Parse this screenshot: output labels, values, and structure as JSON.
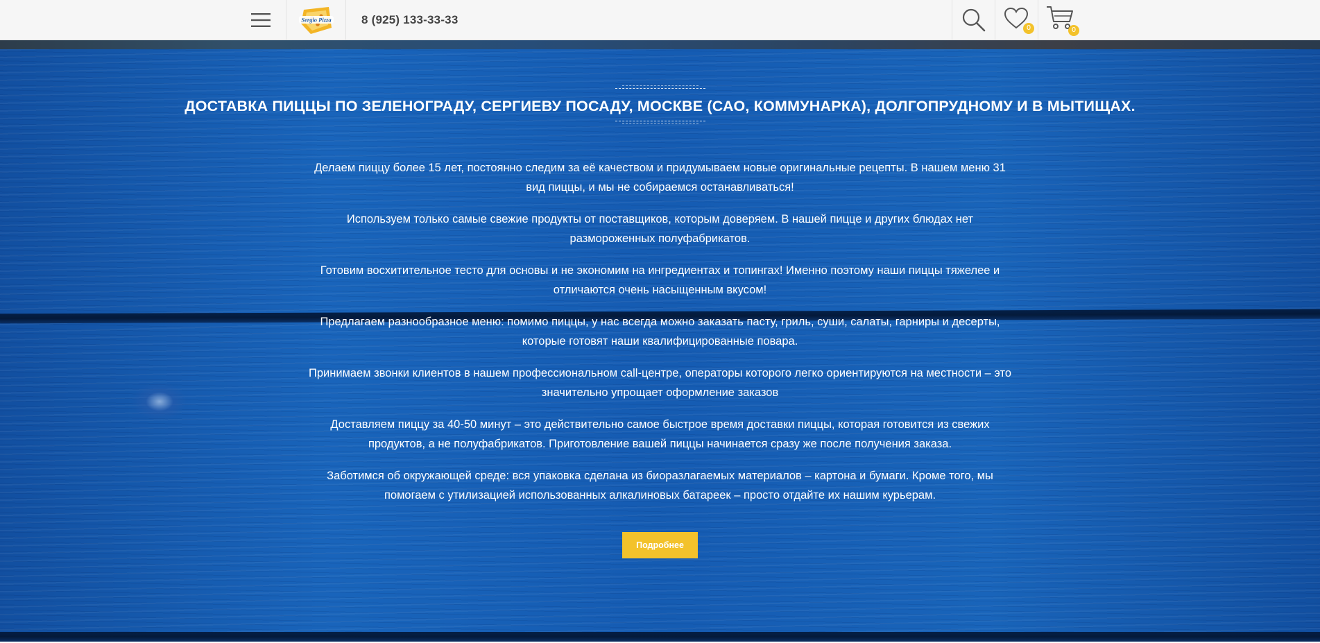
{
  "header": {
    "phone": "8 (925) 133-33-33",
    "logo_text": "Sergio Pizza",
    "wishlist_count": "0",
    "cart_count": "0"
  },
  "hero": {
    "title": "ДОСТАВКА ПИЦЦЫ ПО ЗЕЛЕНОГРАДУ, СЕРГИЕВУ ПОСАДУ, МОСКВЕ (САО, КОММУНАРКА), ДОЛГОПРУДНОМУ И В МЫТИЩАХ.",
    "paragraphs": [
      "Делаем пиццу более 15 лет, постоянно следим за её качеством и придумываем новые оригинальные рецепты. В нашем меню 31 вид пиццы, и мы не собираемся останавливаться!",
      "Используем только самые свежие продукты от поставщиков, которым доверяем. В нашей пицце и других блюдах нет размороженных полуфабрикатов.",
      "Готовим восхитительное тесто для основы и не экономим на ингредиентах и топингах! Именно поэтому наши пиццы тяжелее и отличаются очень насыщенным вкусом!",
      "Предлагаем разнообразное меню: помимо пиццы, у нас всегда можно заказать пасту, гриль, суши, салаты, гарниры и десерты, которые готовят наши квалифицированные повара.",
      "Принимаем звонки клиентов в нашем профессиональном call-центре, операторы которого легко ориентируются на местности – это значительно упрощает оформление заказов",
      "Доставляем пиццу за 40-50 минут – это действительно самое быстрое время доставки пиццы, которая готовится из свежих продуктов, а не полуфабрикатов. Приготовление вашей пиццы начинается сразу же после получения заказа.",
      "Заботимся об окружающей среде: вся упаковка сделана из биоразлагаемых материалов – картона и бумаги. Кроме того, мы помогаем с утилизацией использованных алкалиновых батареек – просто отдайте их нашим курьерам."
    ],
    "more_button": "Подробнее"
  },
  "colors": {
    "accent": "#f3c22b",
    "hero_blue": "#1560b6",
    "header_bg": "#f6f6f6",
    "text_dark": "#444444"
  },
  "icons": [
    "menu-icon",
    "search-icon",
    "heart-icon",
    "cart-icon"
  ]
}
